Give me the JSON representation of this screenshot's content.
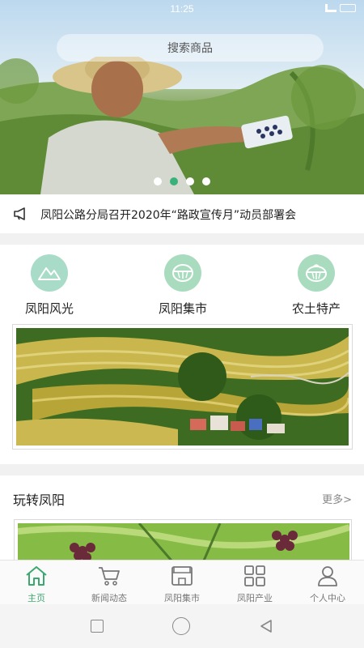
{
  "status_bar": {
    "time": "11:25"
  },
  "search": {
    "placeholder": "搜索商品"
  },
  "carousel": {
    "pages": 4,
    "active_index": 1
  },
  "notice": {
    "text": "凤阳公路分局召开2020年“路政宣传月”动员部署会"
  },
  "categories": [
    {
      "label": "凤阳风光",
      "icon": "mountain-icon"
    },
    {
      "label": "凤阳集市",
      "icon": "market-icon"
    },
    {
      "label": "农土特产",
      "icon": "produce-icon"
    }
  ],
  "section": {
    "title": "玩转凤阳",
    "more": "更多>"
  },
  "tabs": [
    {
      "label": "主页",
      "icon": "home-icon",
      "active": true
    },
    {
      "label": "新闻动态",
      "icon": "cart-icon",
      "active": false
    },
    {
      "label": "凤阳集市",
      "icon": "store-icon",
      "active": false
    },
    {
      "label": "凤阳产业",
      "icon": "grid-icon",
      "active": false
    },
    {
      "label": "个人中心",
      "icon": "person-icon",
      "active": false
    }
  ],
  "colors": {
    "accent": "#3aa86f",
    "icon_circle": "#a9dcc8",
    "divider": "#f1f1f1"
  }
}
